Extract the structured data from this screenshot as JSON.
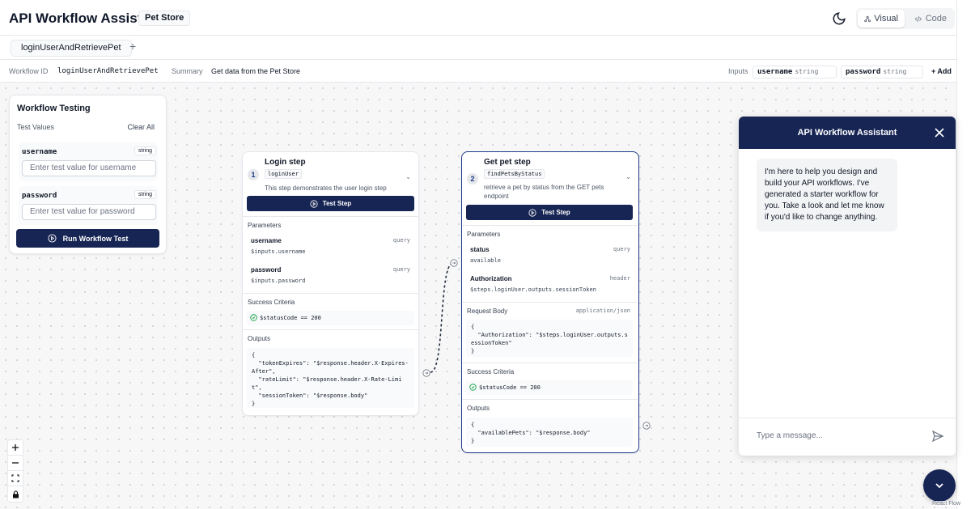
{
  "header": {
    "title": "API Workflow Assistant",
    "project": "Pet Store",
    "view_visual": "Visual",
    "view_code": "Code"
  },
  "tabs": {
    "active": "loginUserAndRetrievePet",
    "add": "+"
  },
  "infobar": {
    "workflow_id_label": "Workflow ID",
    "workflow_id": "loginUserAndRetrievePet",
    "summary_label": "Summary",
    "summary": "Get data from the Pet Store",
    "inputs_label": "Inputs",
    "inputs": [
      {
        "name": "username",
        "type": "string"
      },
      {
        "name": "password",
        "type": "string"
      }
    ],
    "add": "+ Add"
  },
  "testing": {
    "title": "Workflow Testing",
    "subtitle": "Test Values",
    "clear": "Clear All",
    "fields": [
      {
        "name": "username",
        "type": "string",
        "placeholder": "Enter test value for username"
      },
      {
        "name": "password",
        "type": "string",
        "placeholder": "Enter test value for password"
      }
    ],
    "run": "Run Workflow Test"
  },
  "steps": [
    {
      "title": "Login step",
      "number": "1",
      "operation": "loginUser",
      "description": "This step demonstrates the user login step",
      "test": "Test Step",
      "params_title": "Parameters",
      "params": [
        {
          "name": "username",
          "in": "query",
          "value": "$inputs.username"
        },
        {
          "name": "password",
          "in": "query",
          "value": "$inputs.password"
        }
      ],
      "criteria_title": "Success Criteria",
      "criteria": "$statusCode == 200",
      "outputs_title": "Outputs",
      "outputs": "{\n  \"tokenExpires\": \"$response.header.X-Expires-\nAfter\",\n  \"rateLimit\": \"$response.header.X-Rate-Limi\nt\",\n  \"sessionToken\": \"$response.body\"\n}"
    },
    {
      "title": "Get pet step",
      "number": "2",
      "operation": "findPetsByStatus",
      "description_1": "retrieve a pet by status from the GET pets",
      "description_2": "endpoint",
      "test": "Test Step",
      "params_title": "Parameters",
      "params": [
        {
          "name": "status",
          "in": "query",
          "value": "available"
        },
        {
          "name": "Authorization",
          "in": "header",
          "value": "$steps.loginUser.outputs.sessionToken"
        }
      ],
      "body_title": "Request Body",
      "body_type": "application/json",
      "body": "{\n  \"Authorization\": \"$steps.loginUser.outputs.s\nessionToken\"\n}",
      "criteria_title": "Success Criteria",
      "criteria": "$statusCode == 200",
      "outputs_title": "Outputs",
      "outputs": "{\n  \"availablePets\": \"$response.body\"\n}"
    }
  ],
  "chat": {
    "title": "API Workflow Assistant",
    "message": "I'm here to help you design and build your API workflows. I've generated a starter workflow for you. Take a look and let me know if you'd like to change anything.",
    "placeholder": "Type a message..."
  },
  "attribution": "React Flow",
  "colors": {
    "primary": "#172554",
    "accent": "#1e3a8a",
    "success": "#16a34a"
  }
}
